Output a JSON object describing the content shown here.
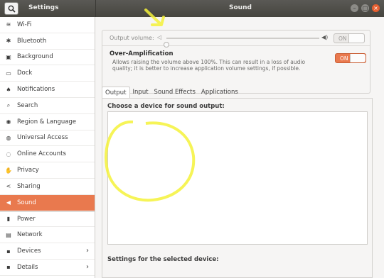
{
  "titlebar": {
    "left_title": "Settings",
    "center_title": "Sound",
    "minimize_glyph": "–",
    "maximize_glyph": "□",
    "close_glyph": "×"
  },
  "sidebar": {
    "items": [
      {
        "label": "Wi-Fi",
        "icon": "wifi-icon",
        "glyph": "≋"
      },
      {
        "label": "Bluetooth",
        "icon": "bluetooth-icon",
        "glyph": "✱"
      },
      {
        "label": "Background",
        "icon": "background-icon",
        "glyph": "▣"
      },
      {
        "label": "Dock",
        "icon": "dock-icon",
        "glyph": "▭"
      },
      {
        "label": "Notifications",
        "icon": "bell-icon",
        "glyph": "♠"
      },
      {
        "label": "Search",
        "icon": "search-icon",
        "glyph": "⌕"
      },
      {
        "label": "Region & Language",
        "icon": "camera-icon",
        "glyph": "◉"
      },
      {
        "label": "Universal Access",
        "icon": "universal-access-icon",
        "glyph": "◍"
      },
      {
        "label": "Online Accounts",
        "icon": "online-accounts-icon",
        "glyph": "◌"
      },
      {
        "label": "Privacy",
        "icon": "privacy-icon",
        "glyph": "✋"
      },
      {
        "label": "Sharing",
        "icon": "sharing-icon",
        "glyph": "<"
      },
      {
        "label": "Sound",
        "icon": "speaker-icon",
        "glyph": "◀"
      },
      {
        "label": "Power",
        "icon": "power-icon",
        "glyph": "▮"
      },
      {
        "label": "Network",
        "icon": "network-icon",
        "glyph": "▤"
      },
      {
        "label": "Devices",
        "icon": "devices-icon",
        "glyph": "▪"
      },
      {
        "label": "Details",
        "icon": "details-icon",
        "glyph": "▪"
      }
    ],
    "active_index": 11
  },
  "volume": {
    "label": "Output volume:",
    "level": 0.0,
    "low_icon_glyph": "◁",
    "high_icon_glyph": "◀)",
    "toggle_label": "ON"
  },
  "amplification": {
    "title": "Over-Amplification",
    "description": "Allows raising the volume above 100%. This can result in a loss of audio quality; it is better to increase application volume settings, if possible.",
    "toggle_label": "ON"
  },
  "tabs": [
    "Output",
    "Input",
    "Sound Effects",
    "Applications"
  ],
  "active_tab": 0,
  "output": {
    "choose_label": "Choose a device for sound output:",
    "settings_label": "Settings for the selected device:"
  },
  "colors": {
    "accent": "#e9794e",
    "annotation": "#f5f23a"
  }
}
